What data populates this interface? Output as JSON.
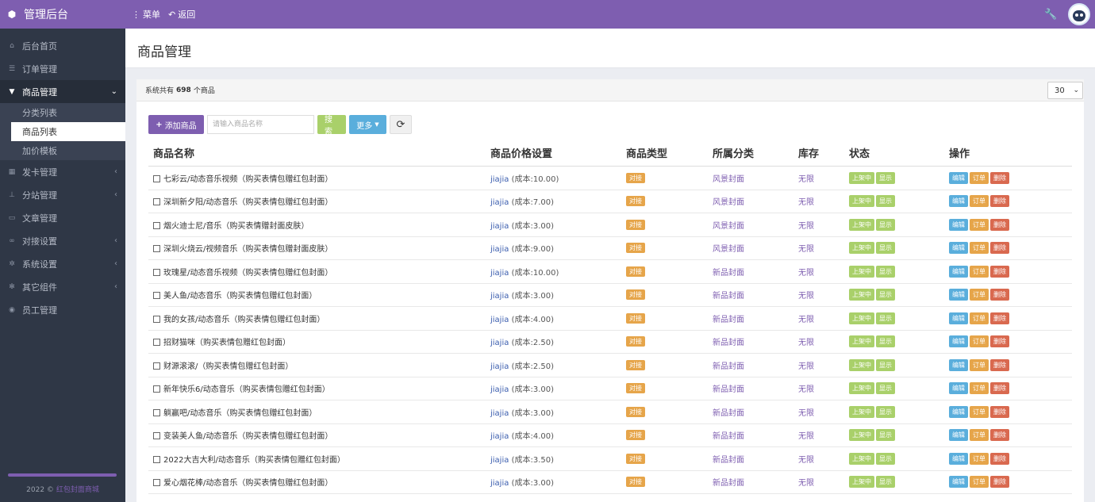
{
  "header": {
    "app_title": "管理后台",
    "menu_label": "菜单",
    "back_label": "返回"
  },
  "sidebar": {
    "items": [
      {
        "label": "后台首页",
        "icon": "home-icon"
      },
      {
        "label": "订单管理",
        "icon": "list-icon"
      },
      {
        "label": "商品管理",
        "icon": "cart-icon",
        "expanded": true
      },
      {
        "label": "发卡管理",
        "icon": "grid-icon"
      },
      {
        "label": "分站管理",
        "icon": "sitemap-icon"
      },
      {
        "label": "文章管理",
        "icon": "book-icon"
      },
      {
        "label": "对接设置",
        "icon": "link-icon"
      },
      {
        "label": "系统设置",
        "icon": "gear-icon"
      },
      {
        "label": "其它组件",
        "icon": "cogs-icon"
      },
      {
        "label": "员工管理",
        "icon": "user-icon"
      }
    ],
    "submenu": [
      "分类列表",
      "商品列表",
      "加价模板"
    ],
    "footer_year": "2022 ©",
    "footer_brand": "红包封面商城"
  },
  "page": {
    "title": "商品管理",
    "summary_prefix": "系统共有",
    "summary_count": "698",
    "summary_suffix": "个商品",
    "page_size": "30"
  },
  "toolbar": {
    "add_label": "添加商品",
    "search_placeholder": "请输入商品名称",
    "search_label": "搜索",
    "more_label": "更多"
  },
  "table": {
    "headers": [
      "商品名称",
      "商品价格设置",
      "商品类型",
      "所属分类",
      "库存",
      "状态",
      "操作"
    ],
    "rows": [
      {
        "name": "七彩云/动态音乐视频（购买表情包赠红包封面）",
        "price_user": "jiajia",
        "price_cost": "(成本:10.00)",
        "type": "对接",
        "category": "风景封面",
        "stock": "无限"
      },
      {
        "name": "深圳新夕阳/动态音乐（购买表情包赠红包封面）",
        "price_user": "jiajia",
        "price_cost": "(成本:7.00)",
        "type": "对接",
        "category": "风景封面",
        "stock": "无限"
      },
      {
        "name": "烟火迪士尼/音乐（购买表情赠封面皮肤）",
        "price_user": "jiajia",
        "price_cost": "(成本:3.00)",
        "type": "对接",
        "category": "风景封面",
        "stock": "无限"
      },
      {
        "name": "深圳火烧云/视频音乐（购买表情包赠封面皮肤）",
        "price_user": "jiajia",
        "price_cost": "(成本:9.00)",
        "type": "对接",
        "category": "风景封面",
        "stock": "无限"
      },
      {
        "name": "玫瑰星/动态音乐视频（购买表情包赠红包封面）",
        "price_user": "jiajia",
        "price_cost": "(成本:10.00)",
        "type": "对接",
        "category": "新品封面",
        "stock": "无限"
      },
      {
        "name": "美人鱼/动态音乐（购买表情包赠红包封面）",
        "price_user": "jiajia",
        "price_cost": "(成本:3.00)",
        "type": "对接",
        "category": "新品封面",
        "stock": "无限"
      },
      {
        "name": "我的女孩/动态音乐（购买表情包赠红包封面）",
        "price_user": "jiajia",
        "price_cost": "(成本:4.00)",
        "type": "对接",
        "category": "新品封面",
        "stock": "无限"
      },
      {
        "name": "招财猫咪（购买表情包赠红包封面）",
        "price_user": "jiajia",
        "price_cost": "(成本:2.50)",
        "type": "对接",
        "category": "新品封面",
        "stock": "无限"
      },
      {
        "name": "财源滚滚/（购买表情包赠红包封面）",
        "price_user": "jiajia",
        "price_cost": "(成本:2.50)",
        "type": "对接",
        "category": "新品封面",
        "stock": "无限"
      },
      {
        "name": "新年快乐6/动态音乐（购买表情包赠红包封面）",
        "price_user": "jiajia",
        "price_cost": "(成本:3.00)",
        "type": "对接",
        "category": "新品封面",
        "stock": "无限"
      },
      {
        "name": "躺赢吧/动态音乐（购买表情包赠红包封面）",
        "price_user": "jiajia",
        "price_cost": "(成本:3.00)",
        "type": "对接",
        "category": "新品封面",
        "stock": "无限"
      },
      {
        "name": "变装美人鱼/动态音乐（购买表情包赠红包封面）",
        "price_user": "jiajia",
        "price_cost": "(成本:4.00)",
        "type": "对接",
        "category": "新品封面",
        "stock": "无限"
      },
      {
        "name": "2022大吉大利/动态音乐（购买表情包赠红包封面）",
        "price_user": "jiajia",
        "price_cost": "(成本:3.50)",
        "type": "对接",
        "category": "新品封面",
        "stock": "无限"
      },
      {
        "name": "爱心烟花棒/动态音乐（购买表情包赠红包封面）",
        "price_user": "jiajia",
        "price_cost": "(成本:3.00)",
        "type": "对接",
        "category": "新品封面",
        "stock": "无限"
      }
    ],
    "status_on": "上架中",
    "status_show": "显示",
    "op_edit": "编辑",
    "op_order": "订单",
    "op_delete": "删除"
  },
  "colors": {
    "accent": "#7e5eb0",
    "sidebar_bg": "#2f3746",
    "green": "#a9d06a",
    "blue": "#5aaedc",
    "orange": "#e6a54a",
    "red": "#d9694f"
  }
}
